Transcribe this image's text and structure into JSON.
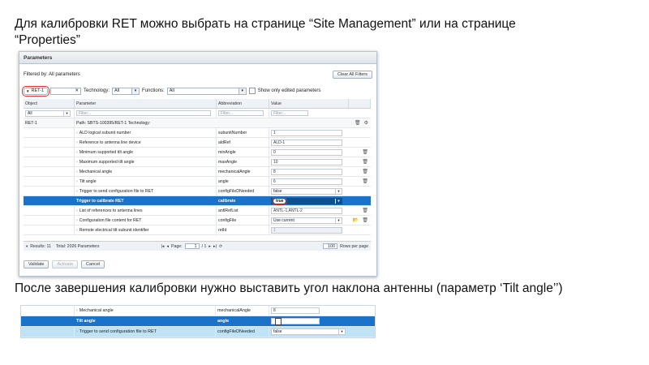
{
  "caption_top": "Для калибровки RET можно выбрать на странице “Site Management” или на странице “Properties”",
  "caption_bottom": "После завершения калибровки нужно выставить угол наклона антенны (параметр ‘Tilt angle’’)",
  "dialog": {
    "title": "Parameters",
    "filtered_by": "Filtered by: All parameters",
    "clear_filters": "Clear All Filters",
    "object_filter_value": "RET-1",
    "technology_label": "Technology:",
    "technology_value": "All",
    "functions_label": "Functions:",
    "functions_value": "All",
    "show_edited": "Show only edited parameters",
    "columns": [
      "Object",
      "Parameter",
      "Abbreviation",
      "Value"
    ],
    "filter_placeholders": {
      "object": "All",
      "parameter": "Filter...",
      "abbreviation": "Filter...",
      "value": "Filter..."
    },
    "group_row": {
      "object": "RET-1",
      "path": "Path: SBTS-100395/RET-1     Technology:"
    },
    "rows": [
      {
        "param": "ALD logical subunit number",
        "abbr": "subunitNumber",
        "value": "1",
        "kind": "input",
        "trash": false
      },
      {
        "param": "Reference to antenna line device",
        "abbr": "aldRef",
        "value": "ALD-1",
        "kind": "input",
        "trash": false
      },
      {
        "param": "Minimum supported tilt angle",
        "abbr": "minAngle",
        "value": "0",
        "kind": "input",
        "trash": true
      },
      {
        "param": "Maximum supported tilt angle",
        "abbr": "maxAngle",
        "value": "10",
        "kind": "input",
        "trash": true
      },
      {
        "param": "Mechanical angle",
        "abbr": "mechanicalAngle",
        "value": "8",
        "kind": "input",
        "trash": true
      },
      {
        "param": "Tilt angle",
        "abbr": "angle",
        "value": "6",
        "kind": "input",
        "trash": true
      },
      {
        "param": "Trigger to send configuration file to RET",
        "abbr": "configFileDNeeded",
        "value": "false",
        "kind": "select",
        "trash": false
      },
      {
        "param": "Trigger to calibrate RET",
        "abbr": "calibrate",
        "value": "true",
        "kind": "selected",
        "trash": false
      },
      {
        "param": "List of references to antenna lines",
        "abbr": "antlRefList",
        "value": "ANTL-1,ANTL-2",
        "kind": "input",
        "trash": true
      },
      {
        "param": "Configuration file content for RET",
        "abbr": "configFile",
        "value": "Use current",
        "kind": "select",
        "trash": true
      },
      {
        "param": "Remote electrical tilt subunit identifier",
        "abbr": "retId",
        "value": "1",
        "kind": "dim",
        "trash": false
      }
    ],
    "footer": {
      "results": "Results: 11",
      "total": "Total: 2026 Parameters",
      "page_label": "Page:",
      "page_value": "1",
      "page_of": "/ 1",
      "per_page_value": "100",
      "per_page_label": "Rows per page"
    },
    "buttons": {
      "validate": "Validate",
      "activate": "Activate",
      "cancel": "Cancel"
    }
  },
  "snippet": {
    "rows": [
      {
        "param": "Mechanical angle",
        "abbr": "mechanicalAngle",
        "value": "8"
      },
      {
        "param": "Tilt angle",
        "abbr": "angle",
        "value": ""
      },
      {
        "param": "Trigger to send configuration file to RET",
        "abbr": "configFileDNeeded",
        "value": "false"
      }
    ]
  },
  "colors": {
    "selection": "#1a73c8",
    "highlight": "#e0312b",
    "row_light_blue": "#bfe3f5"
  },
  "icons": [
    "trash-icon",
    "gear-icon",
    "folder-icon",
    "chevron-down-icon",
    "clear-icon",
    "first-page-icon",
    "prev-page-icon",
    "next-page-icon",
    "last-page-icon",
    "refresh-icon",
    "expand-icon"
  ]
}
